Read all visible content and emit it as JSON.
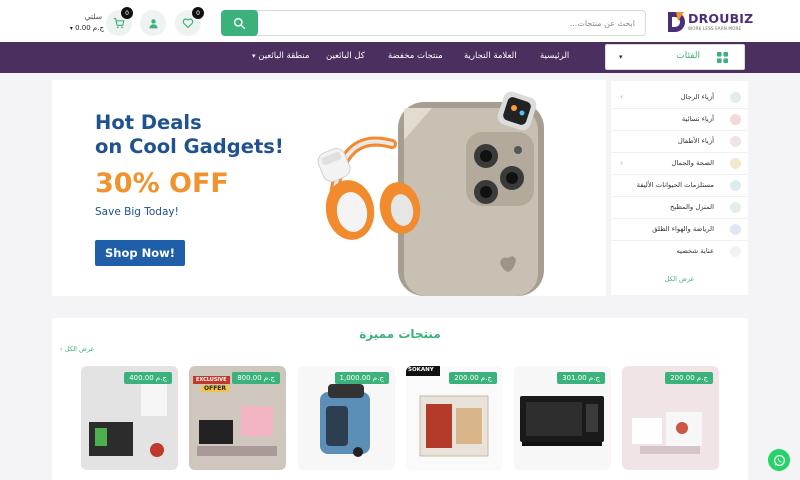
{
  "brand": {
    "name": "DROUBIZ",
    "tagline": "WORK LESS EARN MORE"
  },
  "search": {
    "placeholder": "ابحث عن منتجات..."
  },
  "header": {
    "wishlist_count": "0",
    "cart_count": "0",
    "cart_label": "سلتي",
    "cart_total": "0.00 ج.م"
  },
  "nav": {
    "categories_label": "الفئات",
    "items": [
      "الرئيسية",
      "العلامة التجارية",
      "منتجات مخفضة",
      "كل البائعين",
      "منطقة البائعين"
    ]
  },
  "hero": {
    "title_line1": "Hot Deals",
    "title_line2": "on Cool Gadgets!",
    "discount": "30% OFF",
    "subtitle": "Save Big Today!",
    "cta": "Shop Now!"
  },
  "side_categories": {
    "items": [
      {
        "label": "أزياء الرجال",
        "icon": "shirt-icon",
        "chevron": true
      },
      {
        "label": "أزياء نسائية",
        "icon": "dress-icon",
        "chevron": false
      },
      {
        "label": "أزياء الأطفال",
        "icon": "kids-icon",
        "chevron": false
      },
      {
        "label": "الصحة والجمال",
        "icon": "beauty-icon",
        "chevron": true
      },
      {
        "label": "مستلزمات الحيوانات الأليفة",
        "icon": "pet-icon",
        "chevron": false
      },
      {
        "label": "المنزل والمطبخ",
        "icon": "kitchen-icon",
        "chevron": false
      },
      {
        "label": "الرياضة والهواء الطلق",
        "icon": "sports-icon",
        "chevron": false
      },
      {
        "label": "عناية شخصيه",
        "icon": "care-icon",
        "chevron": false
      }
    ],
    "view_all": "عرض الكل"
  },
  "featured": {
    "title": "منتجات مميزة",
    "view_all": "عرض الكل",
    "products": [
      {
        "price": "200.00 ج.م"
      },
      {
        "price": "301.00 ج.م"
      },
      {
        "price": "200.00 ج.م"
      },
      {
        "price": "1,000.00 ج.م"
      },
      {
        "price": "800.00 ج.م"
      },
      {
        "price": "400.00 ج.م"
      }
    ],
    "image_labels": {
      "brand_sokany": "SOKANY",
      "exclusive": "EXCLUSIVE",
      "offer": "OFFER"
    }
  },
  "colors": {
    "accent": "#3bb27b",
    "nav": "#4a2f5f",
    "hero_blue": "#20528f",
    "hero_orange": "#f0922e"
  }
}
